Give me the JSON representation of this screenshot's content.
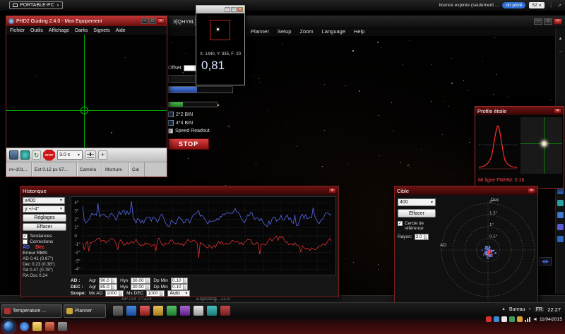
{
  "top_bar": {
    "device": "PORTABLE-PC",
    "licence_text": "licence expirée (seulement ...",
    "private_badge": "on privé",
    "tab_count": "52"
  },
  "main_app": {
    "title": "3[QHY8L]",
    "menu": [
      "Planner",
      "Setup",
      "Zoom",
      "Language",
      "Help"
    ],
    "offset_label": "Offset",
    "bin22": "2*2 BIN",
    "bin44": "4*4 BIN",
    "speed_readout": "Speed Readout",
    "stop_button": "STOP",
    "status_left": "AP754 T=324",
    "status_right": "Exposing...11.6"
  },
  "phd2": {
    "title": "PHD2 Guiding 2.4.0 - Mon Equipement",
    "menu": [
      "Fichier",
      "Outils",
      "Affichage",
      "Darks",
      "Signets",
      "Aide"
    ],
    "stop_label": "STOP",
    "exposure": "3.0 s",
    "status": {
      "mass": "m=101...",
      "guide": "Est 0.12 px 67...",
      "camera": "Caméra",
      "mount": "Monture",
      "cal": "Cal"
    }
  },
  "star_popup": {
    "coords": "X: 1440, Y: 335, F: 20",
    "value": "0,81"
  },
  "profile": {
    "title": "Profile étoile",
    "fwhm": "Mi ligne FWHM: 0.16"
  },
  "historique": {
    "title": "Historique",
    "scale": "x400",
    "yscale": "y:+/-4\"",
    "reglages": "Réglages",
    "effacer": "Effacer",
    "tendances": "Tendances",
    "corrections": "Corrections",
    "legend_ad": "AD",
    "legend_dec": "Dec",
    "rms_title": "Erreur RMS:",
    "rms_ad": "AD 0.41 (0.67\")",
    "rms_dec": "Dec 0.23 (0.38\")",
    "rms_tot": "Tot 0.47 (0.78\")",
    "ra_osc": "RA Osc 0.24",
    "y_ticks": [
      "4\"",
      "3\"",
      "2\"",
      "1\"",
      "0",
      "-1\"",
      "-2\"",
      "-3\"",
      "-4\""
    ],
    "ad_row": {
      "label": "AD :",
      "agr_label": "Agr",
      "agr": "90.0",
      "hys_label": "Hys",
      "hys": "30.00",
      "dp_label": "Dp Min",
      "dp": "0.10"
    },
    "dec_row": {
      "label": "DEC :",
      "agr_label": "Agr",
      "agr": "85.0",
      "hys_label": "Hys",
      "hys": "30.00",
      "dp_label": "Dp Min",
      "dp": "0.10"
    },
    "scope_row": {
      "label": "Scope:",
      "mxad_label": "Mx AD",
      "mxad": "1000",
      "mxdec_label": "Mx DEC",
      "mxdec": "1000",
      "mode": "Auto"
    }
  },
  "cible": {
    "title": "Cible",
    "scale": "400",
    "effacer": "Effacer",
    "cercle_ref": "Cercle de référence",
    "rayon_label": "Rayon:",
    "rayon": "3.0",
    "axis_dec": "Dec",
    "axis_ad": "AD",
    "rings": [
      "0.5\"",
      "1\"",
      "1.5\"",
      "2\""
    ]
  },
  "taskbar": {
    "temperature_button": "Température ...",
    "planner_button": "Planner",
    "bureau": "Bureau",
    "lang": "FR",
    "time": "22:27",
    "date": "11/04/2015"
  }
}
